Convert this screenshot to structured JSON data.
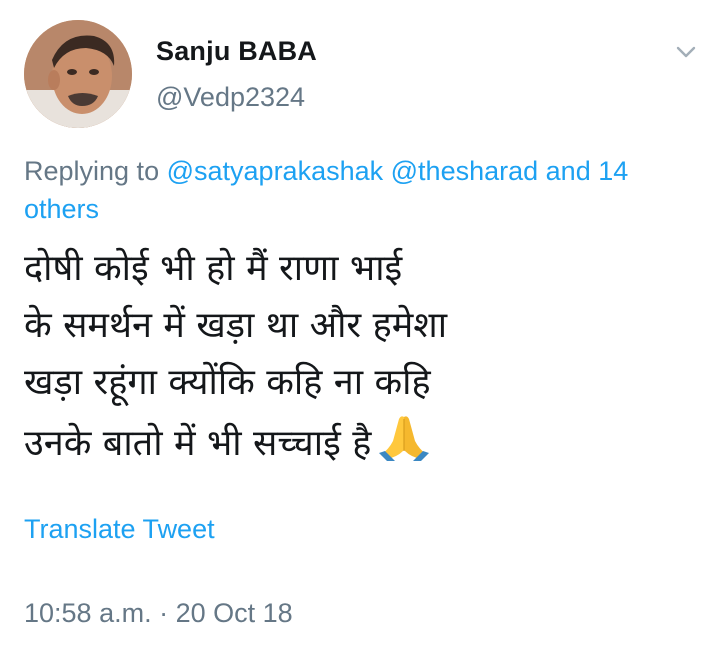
{
  "user": {
    "display_name": "Sanju BABA",
    "handle": "@Vedp2324"
  },
  "menu": {
    "caret_icon": "chevron-down-icon"
  },
  "reply": {
    "prefix": "Replying to",
    "mentions": [
      "@satyaprakashak",
      "@thesharad"
    ],
    "others": "and 14 others"
  },
  "tweet": {
    "lines": [
      "दोषी कोई भी हो मैं राणा भाई",
      "के समर्थन में खड़ा था और हमेशा",
      "खड़ा रहूंगा क्योंकि कहि ना कहि",
      "उनके बातो में भी सच्चाई है"
    ],
    "emoji": "folded-hands-icon"
  },
  "translate_label": "Translate Tweet",
  "timestamp": "10:58 a.m. · 20 Oct 18",
  "colors": {
    "link": "#1da1f2",
    "muted": "#657786",
    "text": "#14171a"
  }
}
